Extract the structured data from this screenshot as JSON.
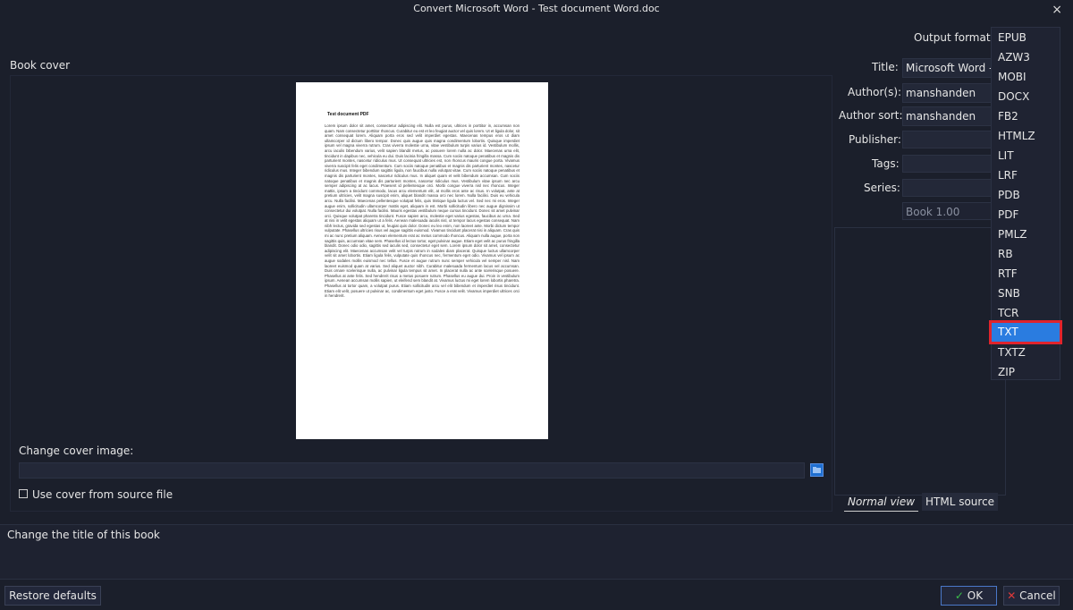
{
  "window": {
    "title": "Convert Microsoft Word - Test document Word.doc",
    "close_glyph": "×"
  },
  "book_cover": {
    "heading": "Book cover",
    "preview": {
      "title": "Test document PDF",
      "body": "Lorem ipsum dolor sit amet, consectetur adipiscing elit. Nulla est purus, ultrices in porttitor in, accumsan non quam. Nam consectetur porttitor rhoncus. Curabitur eu est et leo feugiat auctor vel quis lorem. Ut et ligula dolor, sit amet consequat lorem. Aliquam porta eros sed velit imperdiet egestas. Maecenas tempus eros ut diam ullamcorper id dictum libero tempor. Donec quis augue quis magna condimentum lobortis. Quisque imperdiet ipsum vel magna viverra rutrum. Cras viverra molestie urna, vitae vestibulum turpis varius id. Vestibulum mollis, arcu iaculis bibendum varius, velit sapien blandit metus, ac posuere lorem nulla ac dolor. Maecenas urna elit, tincidunt in dapibus nec, vehicula eu dui. Duis lacinia fringilla massa. Cum sociis natoque penatibus et magnis dis parturient montes, nascetur ridiculus mus. Ut consequat ultricies est, non rhoncus mauris congue porta. Vivamus viverra suscipit felis eget condimentum. Cum sociis natoque penatibus et magnis dis parturient montes, nascetur ridiculus mus. Integer bibendum sagittis ligula, non faucibus nulla volutpat vitae. Cum sociis natoque penatibus et magnis dis parturient montes, nascetur ridiculus mus. In aliquet quam et velit bibendum accumsan. Cum sociis natoque penatibus et magnis dis parturient montes, nascetur ridiculus mus. Vestibulum vitae ipsum nec arcu semper adipiscing at ac lacus. Praesent id pellentesque orci. Morbi congue viverra nisl nec rhoncus. Integer mattis, ipsum a tincidunt commodo, lacus arcu elementum elit, at mollis eros ante ac risus. In volutpat, ante at pretium ultricies, velit magna suscipit enim, aliquet blandit massa orci nec lorem. Nulla facilisi. Duis eu vehicula arcu. Nulla facilisi. Maecenas pellentesque volutpat felis, quis tristique ligula luctus vel. Sed nec mi eros. Integer augue enim, sollicitudin ullamcorper mattis eget, aliquam in est. Morbi sollicitudin libero nec augue dignissim ut consectetur dui volutpat. Nulla facilisi. Mauris egestas vestibulum neque cursus tincidunt. Donec sit amet pulvinar orci. Quisque volutpat pharetra tincidunt. Fusce sapien arcu, molestie eget varius egestas, faucibus ac urna. Sed at nisi in velit egestas aliquam ut a felis. Aenean malesuada iaculis nisl, ut tempor lacus egestas consequat. Nam nibh lectus, gravida sed egestas ut, feugiat quis dolor. Donec eu leo enim, non laoreet ante. Morbi dictum tempor vulputate. Phasellus ultricies risus vel augue sagittis euismod. Vivamus tincidunt placerat nisi in aliquam. Cras quis mi ac nunc pretium aliquam. Aenean elementum erat ac metus commodo rhoncus. Aliquam nulla augue, porta non sagittis quis, accumsan vitae sem. Phasellus id lectus tortor, eget pulvinar augue. Etiam eget velit ac purus fringilla blandit. Donec odio odio, sagittis sed iaculis sed, consectetur eget sem. Lorem ipsum dolor sit amet, consectetur adipiscing elit. Maecenas accumsan velit vel turpis rutrum in sodales diam placerat. Quisque luctus ullamcorper velit sit amet lobortis. Etiam ligula felis, vulputate quis rhoncus nec, fermentum eget odio. Vivamus vel ipsum ac augue sodales mollis euismod nec tellus. Fusce et augue rutrum nunc semper vehicula vel semper nisl. Nam laoreet euismod quam at varius. Sed aliquet auctor nibh. Curabitur malesuada fermentum lacus vel accumsan. Duis ornare scelerisque nulla, ac pulvinar ligula tempus sit amet. In placerat nulla ac ante scelerisque posuere. Phasellus at ante felis. Sed hendrerit risus a metus posuere rutrum. Phasellus eu augue dui. Proin in vestibulum ipsum. Aenean accumsan mollis sapien, ut eleifend sem blandit at. Vivamus luctus mi eget lorem lobortis pharetra. Phasellus at tortor quam, a volutpat purus. Etiam sollicitudin arcu vel elit bibendum et imperdiet risus tincidunt. Etiam elit velit, posuere ut pulvinar ac, condimentum eget justo. Fusce a erat velit. Vivamus imperdiet ultrices orci in hendrerit."
    },
    "change_cover_label": "Change cover image:",
    "change_cover_mnemonic": "c",
    "cover_path_value": "",
    "use_cover_label": "Use cover from source file"
  },
  "metadata": {
    "output_format_label": "Output format:",
    "title_label": "Title:",
    "title_value": "Microsoft Word - T",
    "authors_label": "Author(s):",
    "authors_value": "manshanden",
    "author_sort_label": "Author sort:",
    "author_sort_value": "manshanden",
    "publisher_label": "Publisher:",
    "publisher_value": "",
    "tags_label": "Tags:",
    "tags_value": "",
    "series_label": "Series:",
    "series_value": "",
    "series_index_value": "Book 1.00"
  },
  "tabs": [
    {
      "label": "Normal view",
      "active": true
    },
    {
      "label": "HTML source",
      "active": false
    }
  ],
  "help_text": "Change the title of this book",
  "footer": {
    "restore_label": "Restore defaults",
    "ok_label": "OK",
    "cancel_label": "Cancel"
  },
  "format_options": [
    "EPUB",
    "AZW3",
    "MOBI",
    "DOCX",
    "FB2",
    "HTMLZ",
    "LIT",
    "LRF",
    "PDB",
    "PDF",
    "PMLZ",
    "RB",
    "RTF",
    "SNB",
    "TCR",
    "TXT",
    "TXTZ",
    "ZIP"
  ],
  "selected_format": "TXT",
  "colors": {
    "selection": "#2a7ce0",
    "highlight_box": "#e0242c",
    "ok_check": "#3bbf4a",
    "cancel_x": "#e03a3a"
  }
}
